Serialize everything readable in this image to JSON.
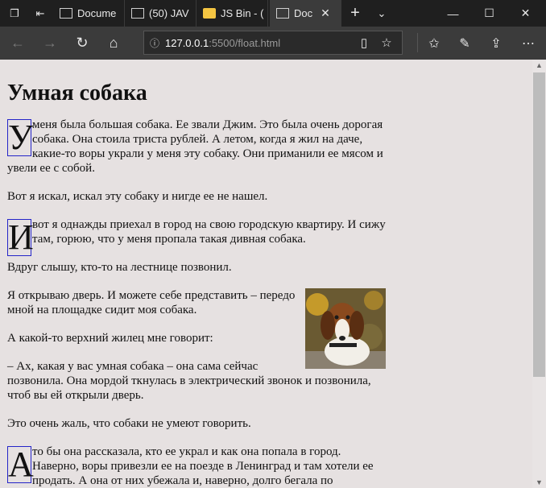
{
  "tabs": [
    {
      "title": "Docume",
      "icon": "page-icon"
    },
    {
      "title": "(50) JAV",
      "icon": "page-icon"
    },
    {
      "title": "JS Bin - (",
      "icon": "jsbin-icon"
    },
    {
      "title": "Doc",
      "icon": "page-icon",
      "active": true
    }
  ],
  "toolbar": {
    "url_host": "127.0.0.1",
    "url_rest": ":5500/float.html"
  },
  "page": {
    "heading": "Умная собака",
    "p1_initial": "У",
    "p1": "меня была большая собака. Ее звали Джим. Это была очень дорогая собака. Она стоила триста рублей. А летом, когда я жил на даче, какие-то воры украли у меня эту собаку. Они приманили ее мясом и увели ее с собой.",
    "p2": "Вот я искал, искал эту собаку и нигде ее не нашел.",
    "p3_initial": "И",
    "p3": "вот я однажды приехал в город на свою городскую квартиру. И сижу там, горюю, что у меня пропала такая дивная собака.",
    "p4": "Вдруг слышу, кто-то на лестнице позвонил.",
    "p5": "Я открываю дверь. И можете себе представить – передо мной на площадке сидит моя собака.",
    "p6": "А какой-то верхний жилец мне говорит:",
    "p7": "– Ах, какая у вас умная собака – она сама сейчас позвонила. Она мордой ткнулась в электрический звонок и позвонила, чтоб вы ей открыли дверь.",
    "p8": "Это очень жаль, что собаки не умеют говорить.",
    "p9_initial": "А",
    "p9": "то бы она рассказала, кто ее украл и как она попала в город. Наверно, воры привезли ее на поезде в Ленинград и там хотели ее продать. А она от них убежала и, наверно, долго бегала по"
  }
}
